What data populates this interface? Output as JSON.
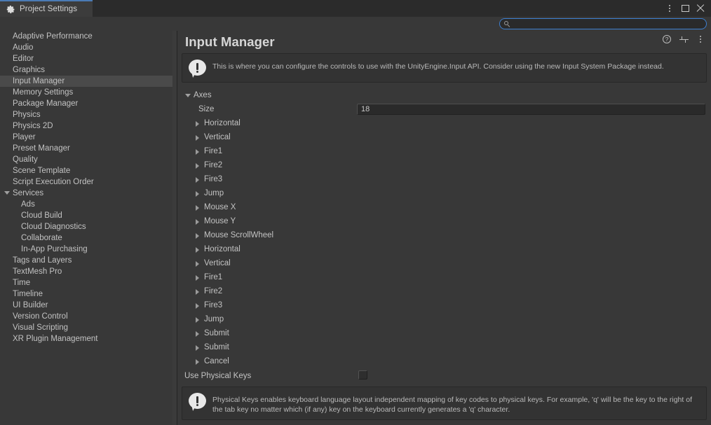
{
  "window": {
    "tab_label": "Project Settings",
    "tab_icon": "gear-icon",
    "accent_color": "#4a7bb5",
    "controls": {
      "menu": "more-options",
      "maximize": "maximize",
      "close": "close"
    }
  },
  "search": {
    "value": "",
    "placeholder": "",
    "icon": "search-icon"
  },
  "sidebar": {
    "items": [
      {
        "label": "Adaptive Performance",
        "selected": false,
        "child": false,
        "expander": ""
      },
      {
        "label": "Audio",
        "selected": false,
        "child": false,
        "expander": ""
      },
      {
        "label": "Editor",
        "selected": false,
        "child": false,
        "expander": ""
      },
      {
        "label": "Graphics",
        "selected": false,
        "child": false,
        "expander": ""
      },
      {
        "label": "Input Manager",
        "selected": true,
        "child": false,
        "expander": ""
      },
      {
        "label": "Memory Settings",
        "selected": false,
        "child": false,
        "expander": ""
      },
      {
        "label": "Package Manager",
        "selected": false,
        "child": false,
        "expander": ""
      },
      {
        "label": "Physics",
        "selected": false,
        "child": false,
        "expander": ""
      },
      {
        "label": "Physics 2D",
        "selected": false,
        "child": false,
        "expander": ""
      },
      {
        "label": "Player",
        "selected": false,
        "child": false,
        "expander": ""
      },
      {
        "label": "Preset Manager",
        "selected": false,
        "child": false,
        "expander": ""
      },
      {
        "label": "Quality",
        "selected": false,
        "child": false,
        "expander": ""
      },
      {
        "label": "Scene Template",
        "selected": false,
        "child": false,
        "expander": ""
      },
      {
        "label": "Script Execution Order",
        "selected": false,
        "child": false,
        "expander": ""
      },
      {
        "label": "Services",
        "selected": false,
        "child": false,
        "expander": "expanded"
      },
      {
        "label": "Ads",
        "selected": false,
        "child": true,
        "expander": ""
      },
      {
        "label": "Cloud Build",
        "selected": false,
        "child": true,
        "expander": ""
      },
      {
        "label": "Cloud Diagnostics",
        "selected": false,
        "child": true,
        "expander": ""
      },
      {
        "label": "Collaborate",
        "selected": false,
        "child": true,
        "expander": ""
      },
      {
        "label": "In-App Purchasing",
        "selected": false,
        "child": true,
        "expander": ""
      },
      {
        "label": "Tags and Layers",
        "selected": false,
        "child": false,
        "expander": ""
      },
      {
        "label": "TextMesh Pro",
        "selected": false,
        "child": false,
        "expander": ""
      },
      {
        "label": "Time",
        "selected": false,
        "child": false,
        "expander": ""
      },
      {
        "label": "Timeline",
        "selected": false,
        "child": false,
        "expander": ""
      },
      {
        "label": "UI Builder",
        "selected": false,
        "child": false,
        "expander": ""
      },
      {
        "label": "Version Control",
        "selected": false,
        "child": false,
        "expander": ""
      },
      {
        "label": "Visual Scripting",
        "selected": false,
        "child": false,
        "expander": ""
      },
      {
        "label": "XR Plugin Management",
        "selected": false,
        "child": false,
        "expander": ""
      }
    ]
  },
  "main": {
    "title": "Input Manager",
    "header_icons": [
      {
        "name": "help-icon",
        "glyph": "?"
      },
      {
        "name": "preset-icon",
        "glyph": ""
      },
      {
        "name": "more-options-icon",
        "glyph": ""
      }
    ],
    "top_info": {
      "icon": "info-bubble-icon",
      "text": "This is where you can configure the controls to use with the UnityEngine.Input API. Consider using the new Input System Package instead."
    },
    "axes_section": {
      "label": "Axes",
      "expanded": true,
      "size_label": "Size",
      "size_value": "18",
      "axes": [
        "Horizontal",
        "Vertical",
        "Fire1",
        "Fire2",
        "Fire3",
        "Jump",
        "Mouse X",
        "Mouse Y",
        "Mouse ScrollWheel",
        "Horizontal",
        "Vertical",
        "Fire1",
        "Fire2",
        "Fire3",
        "Jump",
        "Submit",
        "Submit",
        "Cancel"
      ]
    },
    "physical_keys": {
      "label": "Use Physical Keys",
      "checked": false
    },
    "bottom_info": {
      "icon": "info-bubble-icon",
      "text": "Physical Keys enables keyboard language layout independent mapping of key codes to physical keys. For example, 'q' will be the key to the right of the tab key no matter which (if any) key on the keyboard currently generates a 'q' character."
    }
  }
}
